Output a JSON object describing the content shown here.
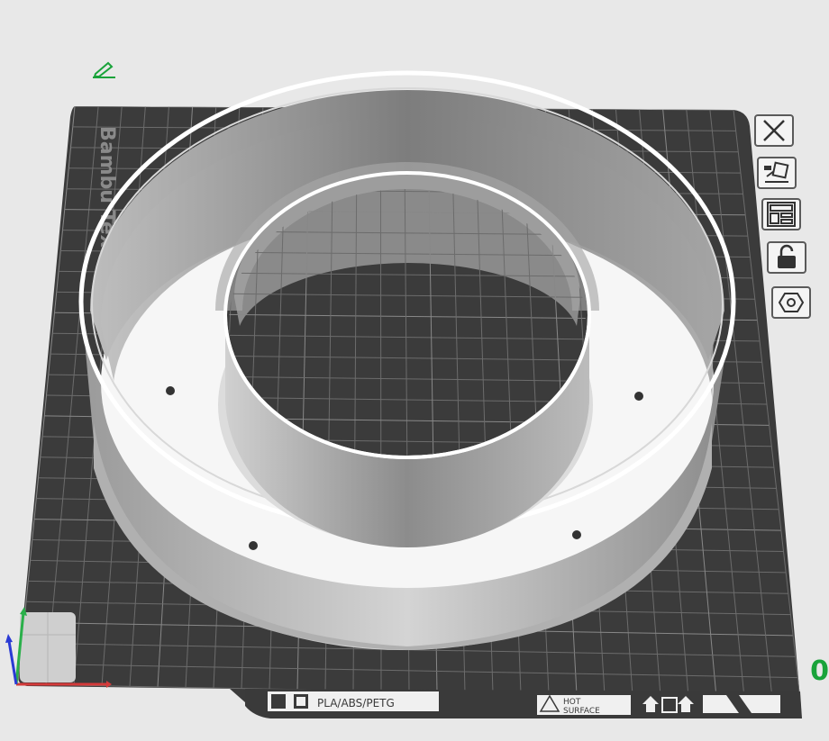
{
  "plate": {
    "brand_text": "Bambu Textu",
    "material_text": "PLA/ABS/PETG",
    "hot_text_1": "HOT",
    "hot_text_2": "SURFACE",
    "plate_index": "0"
  },
  "toolbar": {
    "icons": [
      "close-icon",
      "auto-orient-icon",
      "arrange-icon",
      "lock-icon",
      "settings-icon"
    ]
  },
  "colors": {
    "bed": "#3c3c3c",
    "grid": "#6a6a6a",
    "model": "#c8c8c8",
    "accent": "#19a33a"
  }
}
